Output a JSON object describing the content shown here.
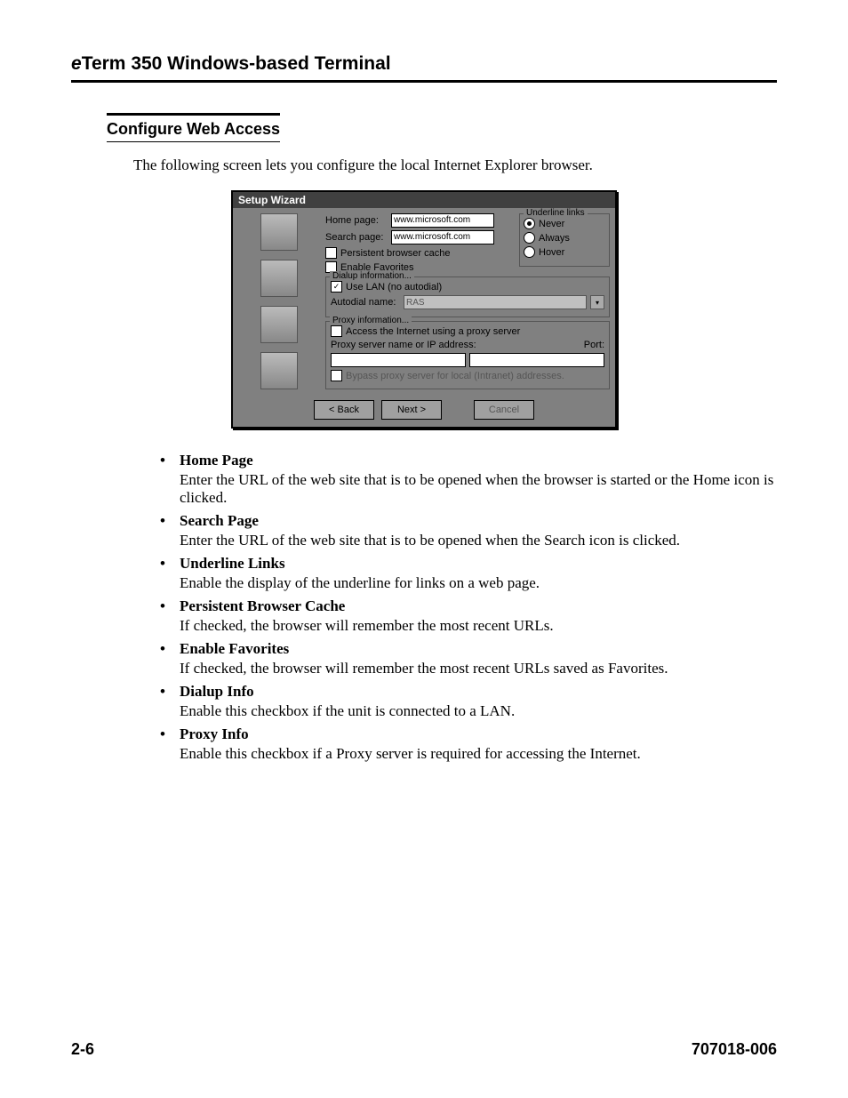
{
  "header": {
    "ital": "e",
    "rest": "Term 350 Windows-based Terminal"
  },
  "section": {
    "title": "Configure Web Access"
  },
  "intro": "The following screen lets you configure the local Internet Explorer browser.",
  "dialog": {
    "title": "Setup Wizard",
    "home_label": "Home page:",
    "home_value": "www.microsoft.com",
    "search_label": "Search page:",
    "search_value": "www.microsoft.com",
    "persistent_label": "Persistent browser cache",
    "favorites_label": "Enable Favorites",
    "dialup_group": "Dialup information...",
    "use_lan_label": "Use LAN (no autodial)",
    "autodial_label": "Autodial name:",
    "autodial_value": "RAS",
    "underline_group": "Underline links",
    "underline_never": "Never",
    "underline_always": "Always",
    "underline_hover": "Hover",
    "proxy_group": "Proxy information...",
    "proxy_use_label": "Access the Internet using a proxy server",
    "proxy_addr_label": "Proxy server name or IP address:",
    "proxy_port_label": "Port:",
    "proxy_bypass_label": "Bypass proxy server for local (Intranet) addresses.",
    "back_btn": "< Back",
    "next_btn": "Next >",
    "cancel_btn": "Cancel"
  },
  "bullets": [
    {
      "title": "Home Page",
      "desc": "Enter the URL of the web site that is to be opened when the browser is started or the Home icon is clicked."
    },
    {
      "title": "Search Page",
      "desc": "Enter the URL of the web site that is to be opened when the Search icon is clicked."
    },
    {
      "title": "Underline Links",
      "desc": "Enable the display of the underline for links on a web page."
    },
    {
      "title": "Persistent Browser Cache",
      "desc": "If checked, the browser will remember the most recent URLs."
    },
    {
      "title": "Enable Favorites",
      "desc": "If checked, the browser will remember the most recent URLs saved as Favorites."
    },
    {
      "title": "Dialup Info",
      "desc": "Enable this checkbox if the unit is connected to a LAN."
    },
    {
      "title": "Proxy Info",
      "desc": "Enable this checkbox if a Proxy server is required for accessing the Internet."
    }
  ],
  "footer": {
    "left": "2-6",
    "right": "707018-006"
  }
}
